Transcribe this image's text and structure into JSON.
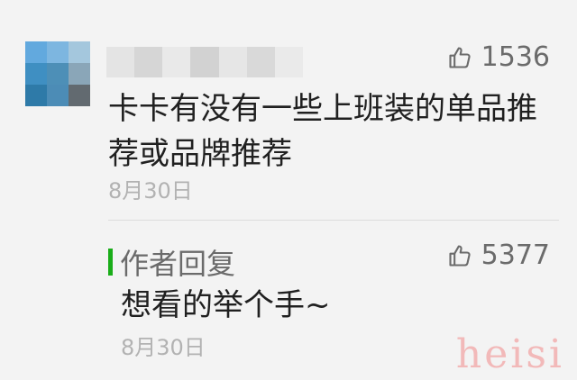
{
  "comment": {
    "avatar_icon": "user-avatar-pixelated",
    "username_hidden": true,
    "like_icon": "thumbs-up-icon",
    "like_count": "1536",
    "text": "卡卡有没有一些上班装的单品推荐或品牌推荐",
    "date": "8月30日"
  },
  "reply": {
    "label": "作者回复",
    "accent_color": "#1aad19",
    "like_icon": "thumbs-up-icon",
    "like_count": "5377",
    "text": "想看的举个手~",
    "date": "8月30日"
  },
  "watermark": {
    "text": "heisi",
    "color": "#f2b9b9"
  }
}
